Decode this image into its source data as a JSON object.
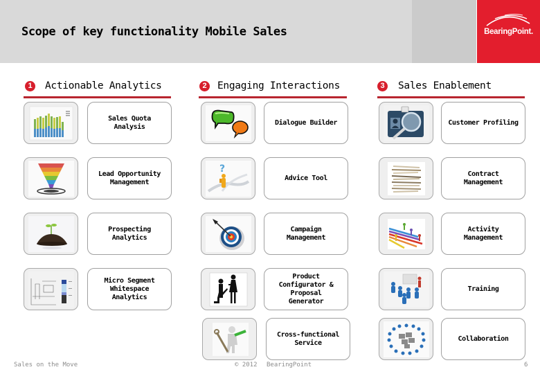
{
  "header": {
    "title": "Scope of key functionality Mobile Sales",
    "logo_text": "BearingPoint.",
    "brand_color": "#e31e2d"
  },
  "sections": [
    {
      "number": "1",
      "title": "Actionable Analytics",
      "items": [
        {
          "label": "Sales Quota\n Analysis",
          "icon": "stacked-bar-chart-icon"
        },
        {
          "label": "Lead Opportunity\n Management",
          "icon": "sales-funnel-icon"
        },
        {
          "label": "Prospecting\n Analytics",
          "icon": "seedling-soil-icon"
        },
        {
          "label": "Micro Segment\n Whitespace\n Analytics",
          "icon": "segment-diagram-icon"
        }
      ]
    },
    {
      "number": "2",
      "title": "Engaging Interactions",
      "items": [
        {
          "label": "Dialogue Builder",
          "icon": "speech-bubbles-icon"
        },
        {
          "label": "Advice Tool",
          "icon": "question-figure-icon"
        },
        {
          "label": "Campaign\n Management",
          "icon": "dart-target-icon"
        },
        {
          "label": "Product\n Configurator &\n Proposal\n Generator",
          "icon": "proposal-figures-icon"
        },
        {
          "label": "Cross-functional\n Service",
          "icon": "wrench-figure-icon"
        }
      ]
    },
    {
      "number": "3",
      "title": "Sales Enablement",
      "items": [
        {
          "label": "Customer Profiling",
          "icon": "id-card-magnifier-icon"
        },
        {
          "label": "Contract\n Management",
          "icon": "paper-stack-icon"
        },
        {
          "label": "Activity\n Management",
          "icon": "race-arrows-icon"
        },
        {
          "label": "Training",
          "icon": "presentation-audience-icon"
        },
        {
          "label": "Collaboration",
          "icon": "puzzle-circle-icon"
        }
      ]
    }
  ],
  "footer": {
    "left": "Sales on the Move",
    "copyright": "© 2012",
    "company": "BearingPoint",
    "page_number": "6"
  }
}
